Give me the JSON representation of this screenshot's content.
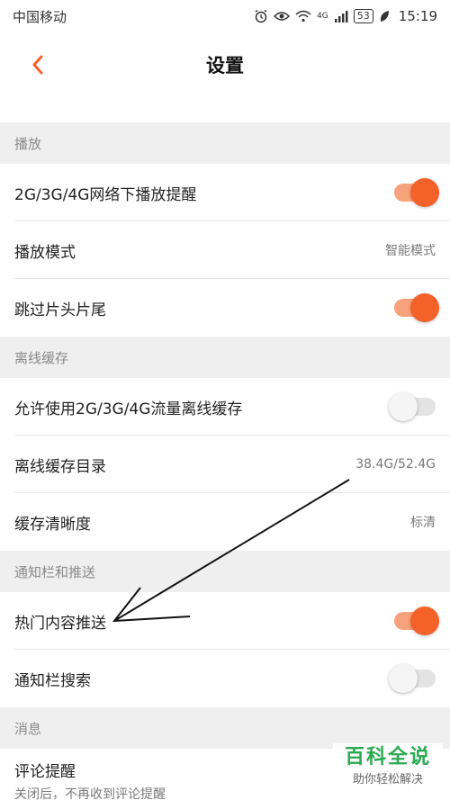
{
  "status_bar": {
    "carrier": "中国移动",
    "network": "4G",
    "battery": "53",
    "time": "15:19"
  },
  "nav": {
    "title": "设置"
  },
  "sections": {
    "playback": {
      "header": "播放",
      "network_reminder": {
        "label": "2G/3G/4G网络下播放提醒",
        "on": true
      },
      "play_mode": {
        "label": "播放模式",
        "value": "智能模式"
      },
      "skip_intro": {
        "label": "跳过片头片尾",
        "on": true
      }
    },
    "offline": {
      "header": "离线缓存",
      "allow_mobile": {
        "label": "允许使用2G/3G/4G流量离线缓存",
        "on": false
      },
      "directory": {
        "label": "离线缓存目录",
        "value": "38.4G/52.4G"
      },
      "quality": {
        "label": "缓存清晰度",
        "value": "标清"
      }
    },
    "notify": {
      "header": "通知栏和推送",
      "hot_push": {
        "label": "热门内容推送",
        "on": true
      },
      "bar_search": {
        "label": "通知栏搜索",
        "on": false
      }
    },
    "message": {
      "header": "消息",
      "comment_reminder": {
        "label": "评论提醒",
        "sub": "关闭后，不再收到评论提醒"
      }
    }
  },
  "watermark": {
    "big": "百科全说",
    "small": "助你轻松解决"
  },
  "colors": {
    "accent": "#f4622a",
    "watermark_green": "#2aa94f"
  }
}
